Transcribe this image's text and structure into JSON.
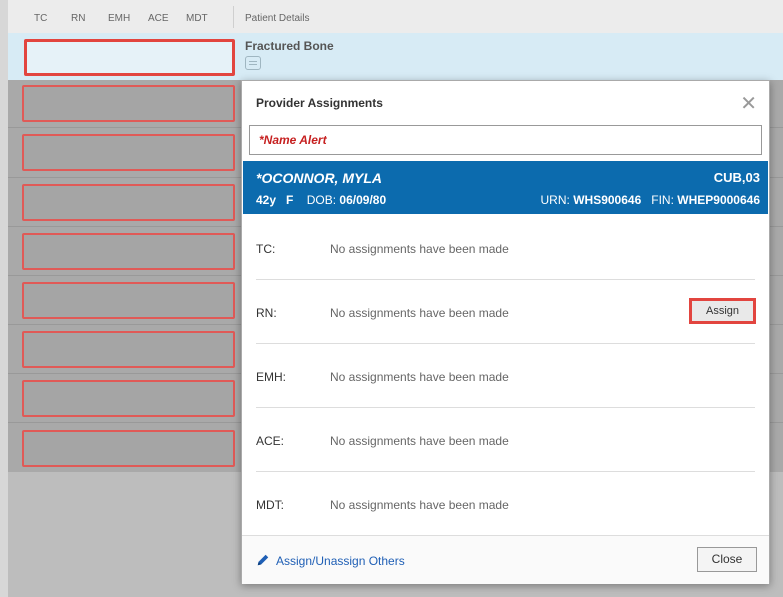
{
  "header": {
    "columns": [
      "TC",
      "RN",
      "EMH",
      "ACE",
      "MDT"
    ],
    "details_label": "Patient Details"
  },
  "selected_row": {
    "diagnosis": "Fractured Bone"
  },
  "modal": {
    "title": "Provider Assignments",
    "close_icon": "close-icon",
    "name_alert": "*Name Alert",
    "patient": {
      "name": "*OCONNOR, MYLA",
      "location": "CUB,03",
      "age": "42y",
      "sex": "F",
      "dob_label": "DOB:",
      "dob": "06/09/80",
      "urn_label": "URN:",
      "urn": "WHS900646",
      "fin_label": "FIN:",
      "fin": "WHEP9000646"
    },
    "assignments": [
      {
        "role": "TC:",
        "status": "No assignments have been made"
      },
      {
        "role": "RN:",
        "status": "No assignments have been made",
        "action": "Assign"
      },
      {
        "role": "EMH:",
        "status": "No assignments have been made"
      },
      {
        "role": "ACE:",
        "status": "No assignments have been made"
      },
      {
        "role": "MDT:",
        "status": "No assignments have been made"
      }
    ],
    "footer": {
      "link": "Assign/Unassign Others",
      "close": "Close"
    }
  },
  "colors": {
    "accent_blue": "#0c6bae",
    "highlight_red": "#e2453f",
    "alert_red": "#c62020",
    "link_blue": "#1f5fb5"
  }
}
